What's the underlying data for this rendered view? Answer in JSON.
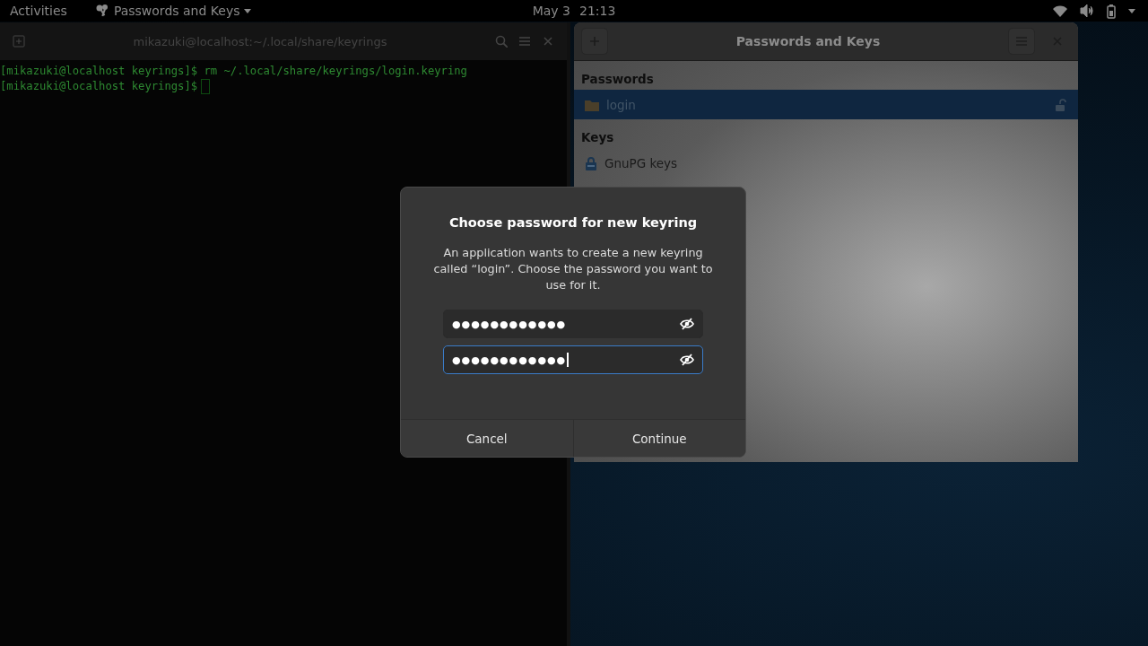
{
  "top_bar": {
    "activities": "Activities",
    "app_menu": "Passwords and Keys",
    "date": "May 3",
    "time": "21:13"
  },
  "terminal": {
    "title": "mikazuki@localhost:~/.local/share/keyrings",
    "lines": [
      {
        "text": "[mikazuki@localhost keyrings]$ rm ~/.local/share/keyrings/login.keyring",
        "cursor": false
      },
      {
        "text": "[mikazuki@localhost keyrings]$",
        "cursor": true
      }
    ]
  },
  "keys_window": {
    "title": "Passwords and Keys",
    "sections": [
      {
        "heading": "Passwords",
        "items": [
          {
            "label": "login",
            "kind": "keyring",
            "selected": true
          }
        ]
      },
      {
        "heading": "Keys",
        "items": [
          {
            "label": "GnuPG keys",
            "kind": "gnupg",
            "selected": false
          }
        ]
      }
    ]
  },
  "dialog": {
    "title": "Choose password for new keyring",
    "message": "An application wants to create a new keyring called “login”. Choose the password you want to use for it.",
    "fields": [
      {
        "value": "●●●●●●●●●●●●",
        "focused": false
      },
      {
        "value": "●●●●●●●●●●●●",
        "focused": true
      }
    ],
    "buttons": [
      "Cancel",
      "Continue"
    ]
  }
}
